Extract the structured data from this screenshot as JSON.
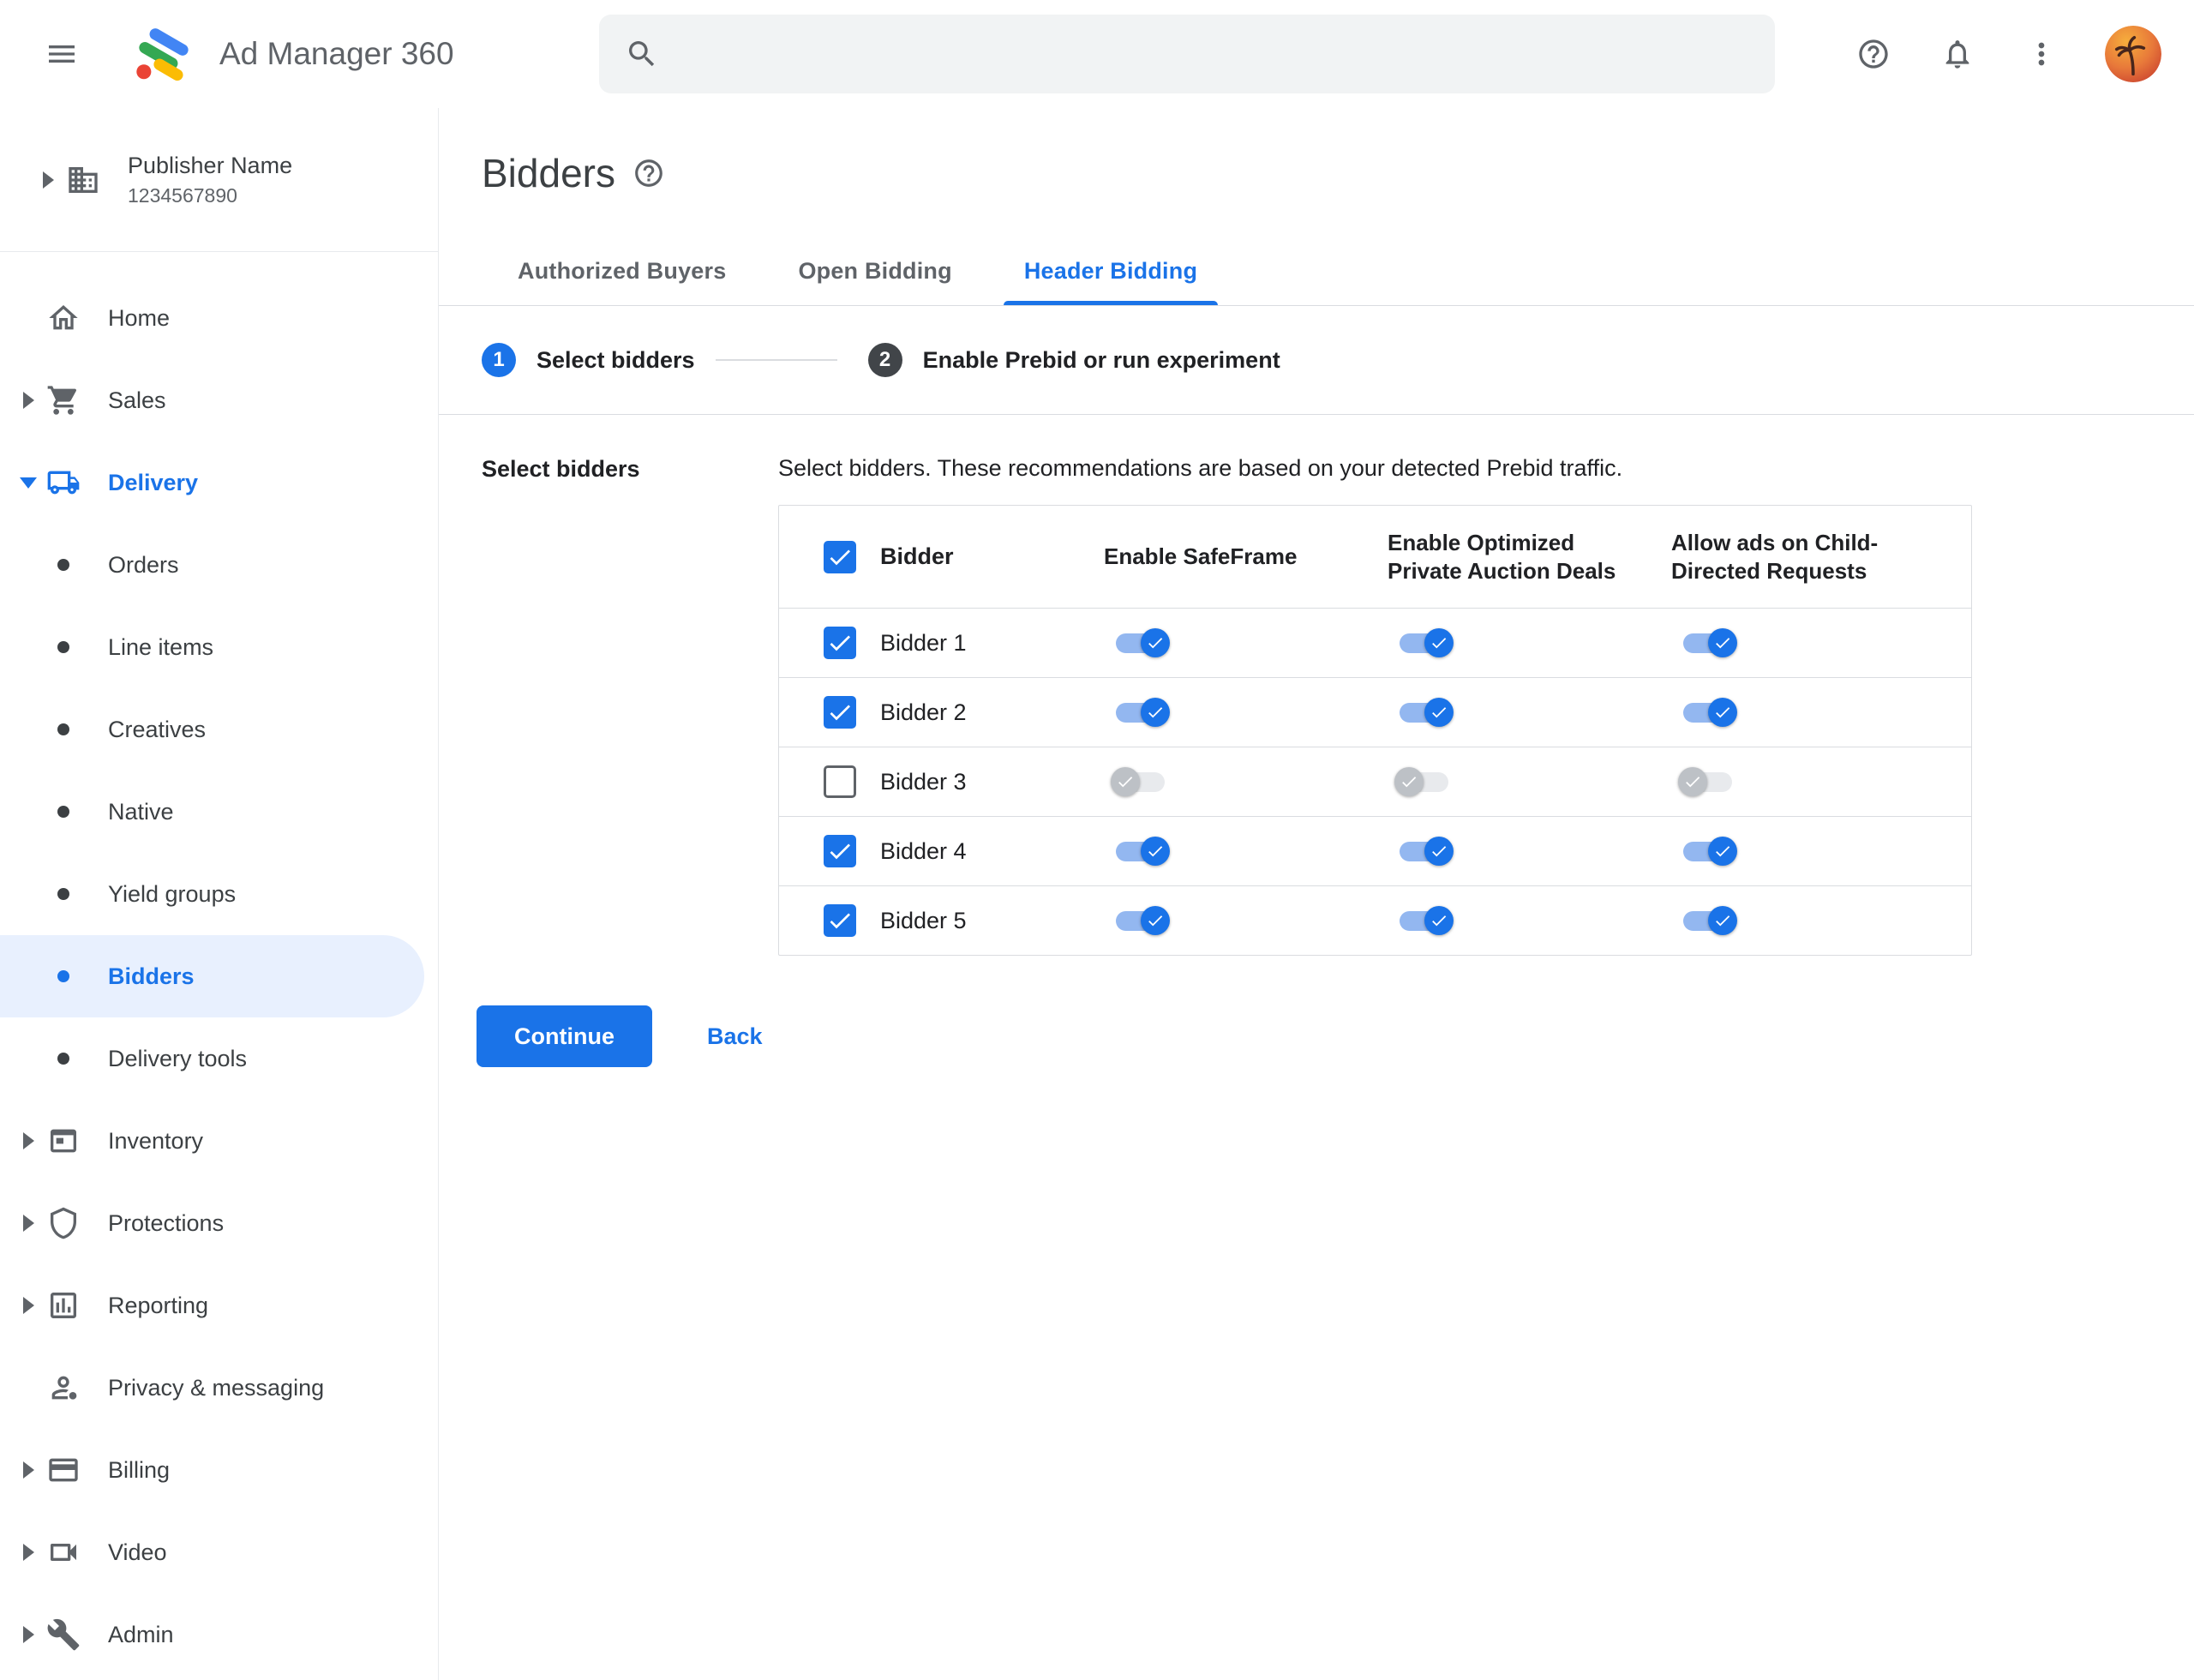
{
  "topbar": {
    "app_title": "Ad Manager 360",
    "search": {
      "value": "",
      "placeholder": ""
    }
  },
  "sidebar": {
    "publisher": {
      "name": "Publisher Name",
      "id": "1234567890"
    },
    "items": [
      {
        "label": "Home",
        "icon": "home",
        "arrow": null,
        "active": false,
        "selected": false
      },
      {
        "label": "Sales",
        "icon": "cart",
        "arrow": "right",
        "active": false,
        "selected": false
      },
      {
        "label": "Delivery",
        "icon": "truck",
        "arrow": "down",
        "active": true,
        "selected": false
      },
      {
        "label": "Orders",
        "icon": "bullet",
        "arrow": null,
        "active": false,
        "selected": false
      },
      {
        "label": "Line items",
        "icon": "bullet",
        "arrow": null,
        "active": false,
        "selected": false
      },
      {
        "label": "Creatives",
        "icon": "bullet",
        "arrow": null,
        "active": false,
        "selected": false
      },
      {
        "label": "Native",
        "icon": "bullet",
        "arrow": null,
        "active": false,
        "selected": false
      },
      {
        "label": "Yield groups",
        "icon": "bullet",
        "arrow": null,
        "active": false,
        "selected": false
      },
      {
        "label": "Bidders",
        "icon": "bullet",
        "arrow": null,
        "active": false,
        "selected": true
      },
      {
        "label": "Delivery tools",
        "icon": "bullet",
        "arrow": null,
        "active": false,
        "selected": false
      },
      {
        "label": "Inventory",
        "icon": "web",
        "arrow": "right",
        "active": false,
        "selected": false
      },
      {
        "label": "Protections",
        "icon": "shield",
        "arrow": "right",
        "active": false,
        "selected": false
      },
      {
        "label": "Reporting",
        "icon": "chart",
        "arrow": "right",
        "active": false,
        "selected": false
      },
      {
        "label": "Privacy & messaging",
        "icon": "person",
        "arrow": null,
        "active": false,
        "selected": false
      },
      {
        "label": "Billing",
        "icon": "card",
        "arrow": "right",
        "active": false,
        "selected": false
      },
      {
        "label": "Video",
        "icon": "video",
        "arrow": "right",
        "active": false,
        "selected": false
      },
      {
        "label": "Admin",
        "icon": "wrench",
        "arrow": "right",
        "active": false,
        "selected": false
      }
    ]
  },
  "main": {
    "page_title": "Bidders",
    "tabs": [
      {
        "label": "Authorized Buyers",
        "active": false
      },
      {
        "label": "Open Bidding",
        "active": false
      },
      {
        "label": "Header Bidding",
        "active": true
      }
    ],
    "stepper": [
      {
        "number": "1",
        "label": "Select bidders"
      },
      {
        "number": "2",
        "label": "Enable Prebid or run experiment"
      }
    ],
    "section_label": "Select bidders",
    "description": "Select bidders. These recommendations are based on your detected Prebid traffic.",
    "table": {
      "select_all": true,
      "columns": [
        "Bidder",
        "Enable SafeFrame",
        "Enable Optimized Private Auction Deals",
        "Allow ads on Child-Directed Requests"
      ],
      "rows": [
        {
          "bidder": "Bidder 1",
          "selected": true,
          "safeframe": true,
          "optimized_deals": true,
          "child_directed": true
        },
        {
          "bidder": "Bidder 2",
          "selected": true,
          "safeframe": true,
          "optimized_deals": true,
          "child_directed": true
        },
        {
          "bidder": "Bidder 3",
          "selected": false,
          "safeframe": false,
          "optimized_deals": false,
          "child_directed": false
        },
        {
          "bidder": "Bidder 4",
          "selected": true,
          "safeframe": true,
          "optimized_deals": true,
          "child_directed": true
        },
        {
          "bidder": "Bidder 5",
          "selected": true,
          "safeframe": true,
          "optimized_deals": true,
          "child_directed": true
        }
      ]
    },
    "actions": {
      "continue": "Continue",
      "back": "Back"
    }
  },
  "colors": {
    "accent": "#1a73e8",
    "selected_pill": "#e8f0fe",
    "toggle_on_track": "#93b7f0",
    "toggle_off_thumb": "#bdc1c6",
    "border": "#dadce0",
    "text_secondary": "#5f6368"
  }
}
